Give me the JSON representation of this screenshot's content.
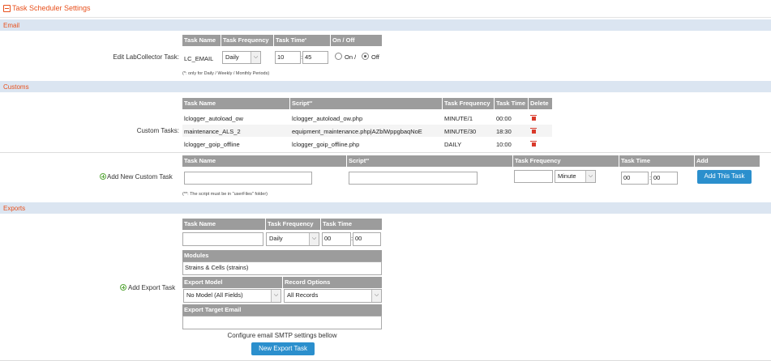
{
  "title": "Task Scheduler Settings",
  "email": {
    "section": "Email",
    "label": "Edit LabCollector Task:",
    "headers": [
      "Task Name",
      "Task Frequency",
      "Task Time",
      "*",
      "On / Off"
    ],
    "task_name": "LC_EMAIL",
    "frequency": "Daily",
    "hour": "10",
    "minute": "45",
    "sep": ":",
    "on_label": "On /",
    "off_label": "Off",
    "note": "(*: only for Daily / Weekly / Monthly Periods)"
  },
  "customs": {
    "section": "Customs",
    "label": "Custom Tasks:",
    "headers": [
      "Task Name",
      "Script",
      "**",
      "Task Frequency",
      "Task Time",
      "Delete"
    ],
    "rows": [
      {
        "name": "lclogger_autoload_ow",
        "script": "lclogger_autoload_ow.php",
        "freq": "MINUTE/1",
        "time": "00:00"
      },
      {
        "name": "maintenance_ALS_2",
        "script": "equipment_maintenance.php|AZblWppgbaqNoE",
        "freq": "MINUTE/30",
        "time": "18:30"
      },
      {
        "name": "lclogger_goip_offline",
        "script": "lclogger_goip_offline.php",
        "freq": "DAILY",
        "time": "10:00"
      }
    ],
    "add_label": "Add New Custom Task",
    "add_headers": [
      "Task Name",
      "Script",
      "**",
      "Task Frequency",
      "Task Time",
      "Add"
    ],
    "add_unit": "Minute",
    "add_hour": "00",
    "add_minute": "00",
    "add_button": "Add This Task",
    "note": "(**: The script must be in \"userFiles\" folder)"
  },
  "exports": {
    "section": "Exports",
    "label": "Add Export Task",
    "headers": [
      "Task Name",
      "Task Frequency",
      "Task Time"
    ],
    "frequency": "Daily",
    "hour": "00",
    "minute": "00",
    "modules_header": "Modules",
    "modules": [
      "Strains & Cells (strains)"
    ],
    "export_model_header": "Export Model",
    "record_options_header": "Record Options",
    "export_model": "No Model (All Fields)",
    "record_options": "All Records",
    "target_email_header": "Export Target Email",
    "smtp_note": "Configure email SMTP settings bellow",
    "button": "New Export Task"
  }
}
